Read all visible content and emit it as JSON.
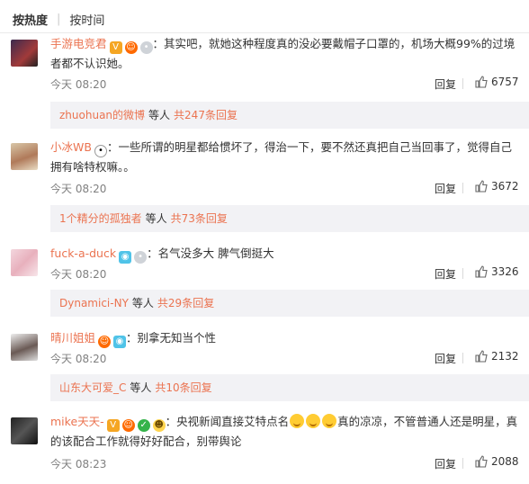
{
  "tabs": {
    "hot": "按热度",
    "separator": "|",
    "time": "按时间"
  },
  "comments": [
    {
      "user": "手游电竞君",
      "text": "：其实吧，就她这种程度真的没必要戴帽子口罩的，机场大概99%的过境者都不认识她。",
      "time": "今天 08:20",
      "reply": "回复",
      "likes": "6757",
      "sub": {
        "who": "zhuohuan的微博",
        "mid": "等人",
        "count": "共247条回复"
      }
    },
    {
      "user": "小冰WB",
      "text": "：一些所谓的明星都给惯坏了，得治一下，要不然还真把自己当回事了，觉得自己拥有啥特权嘛。。",
      "time": "今天 08:20",
      "reply": "回复",
      "likes": "3672",
      "sub": {
        "who": "1个精分的孤独者",
        "mid": "等人",
        "count": "共73条回复"
      }
    },
    {
      "user": "fuck-a-duck",
      "text": "：名气没多大 脾气倒挺大",
      "time": "今天 08:20",
      "reply": "回复",
      "likes": "3326",
      "sub": {
        "who": "Dynamici-NY",
        "mid": "等人",
        "count": "共29条回复"
      }
    },
    {
      "user": "晴川姐姐",
      "text": "：别拿无知当个性",
      "time": "今天 08:20",
      "reply": "回复",
      "likes": "2132",
      "sub": {
        "who": "山东大可爱_C",
        "mid": "等人",
        "count": "共10条回复"
      }
    },
    {
      "user": "mike天天-",
      "text_a": "：央视新闻直接艾特点名",
      "text_b": "真的凉凉，不管普通人还是明星，真的该配合工作就得好好配合，别带舆论",
      "time": "今天 08:23",
      "reply": "回复",
      "likes": "2088"
    }
  ]
}
